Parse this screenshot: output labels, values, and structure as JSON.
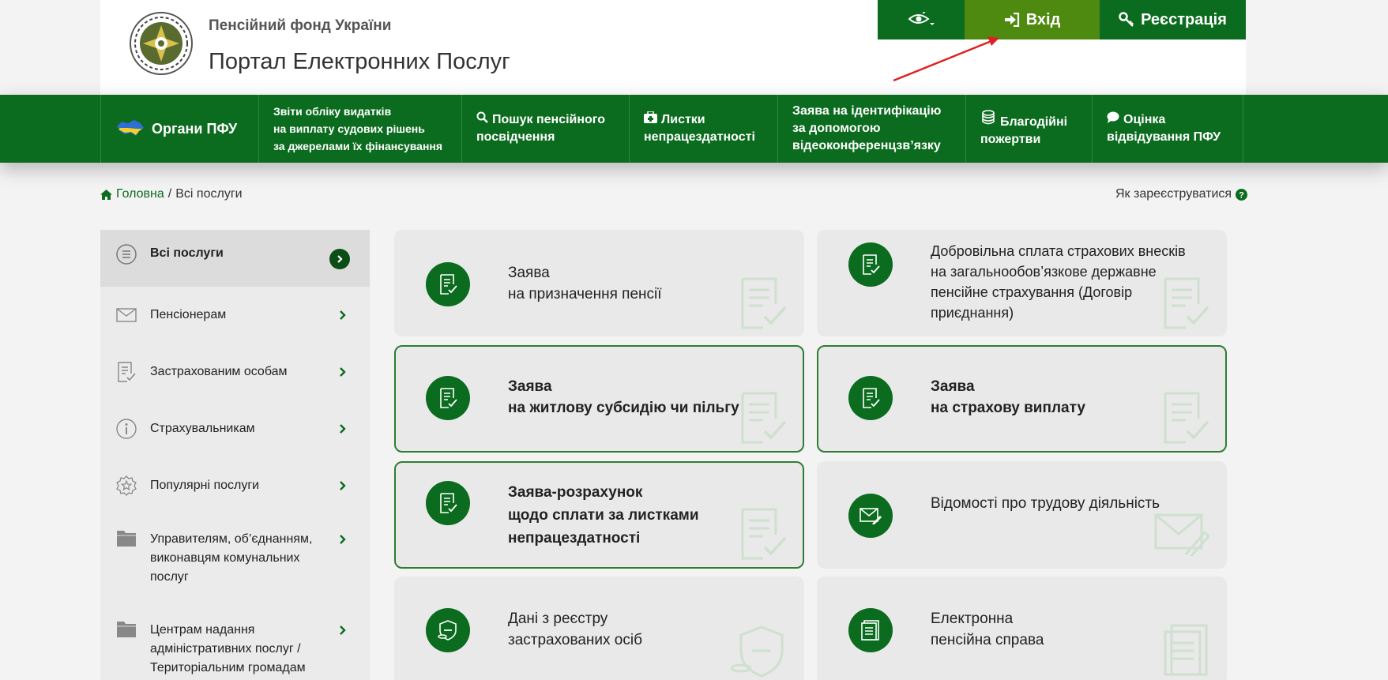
{
  "header": {
    "org_name": "Пенсійний фонд України",
    "portal_name": "Портал Електронних Послуг",
    "accessibility_icon": "eye-icon",
    "login_label": "Вхід",
    "register_label": "Реєстрація"
  },
  "nav": {
    "items": [
      {
        "label": "Органи ПФУ",
        "icon": "ukraine-map-icon"
      },
      {
        "line1": "Звіти обліку видатків",
        "line2": "на виплату судових рішень",
        "line3": "за джерелами їх фінансування"
      },
      {
        "line1": "Пошук пенсійного",
        "line2": "посвідчення",
        "icon": "search-icon"
      },
      {
        "line1": "Листки",
        "line2": "непрацездатності",
        "icon": "medkit-icon"
      },
      {
        "line1": "Заява на ідентифікацію",
        "line2": "за допомогою",
        "line3": "відеоконференцзв’язку"
      },
      {
        "line1": "Благодійні",
        "line2": "пожертви",
        "icon": "coins-icon"
      },
      {
        "line1": "Оцінка",
        "line2": "відвідування ПФУ",
        "icon": "comment-icon"
      }
    ]
  },
  "breadcrumb": {
    "home": "Головна",
    "separator": "/",
    "current": "Всі послуги"
  },
  "help": {
    "how_register": "Як зареєструватися"
  },
  "sidebar": {
    "items": [
      {
        "label": "Всі послуги",
        "icon": "list-icon",
        "active": true
      },
      {
        "label": "Пенсіонерам",
        "icon": "envelope-icon"
      },
      {
        "label": "Застрахованим особам",
        "icon": "document-check-icon"
      },
      {
        "label": "Страхувальникам",
        "icon": "info-icon"
      },
      {
        "label": "Популярні послуги",
        "icon": "star-badge-icon"
      },
      {
        "line1": "Управителям, об’єднанням,",
        "line2": "виконавцям комунальних",
        "line3": "послуг",
        "icon": "folder-icon"
      },
      {
        "line1": "Центрам надання",
        "line2": "адміністративних послуг /",
        "line3": "Територіальним громадам",
        "icon": "folder-icon"
      }
    ]
  },
  "cards": [
    {
      "line1": "Заява",
      "line2": "на призначення пенсії",
      "icon": "document-check-icon"
    },
    {
      "line1": "Добровільна сплата страхових внесків",
      "line2": "на загальнообов’язкове державне",
      "line3": "пенсійне страхування (Договір",
      "line4": "приєднання)",
      "icon": "document-check-icon"
    },
    {
      "line1": "Заява",
      "line2": "на житлову субсидію чи пільгу",
      "icon": "document-check-icon"
    },
    {
      "line1": "Заява",
      "line2": "на страхову виплату",
      "icon": "document-check-icon"
    },
    {
      "line1": "Заява-розрахунок",
      "line2": "щодо сплати за листками",
      "line3": "непрацездатності",
      "icon": "document-check-icon"
    },
    {
      "line1": "Відомості про трудову діяльність",
      "icon": "envelope-pen-icon"
    },
    {
      "line1": "Дані з реєстру",
      "line2": "застрахованих осіб",
      "icon": "shield-coins-icon"
    },
    {
      "line1": "Електронна",
      "line2": "пенсійна справа",
      "icon": "folder-document-icon"
    }
  ],
  "colors": {
    "primary_green": "#0b6b1e",
    "login_green": "#4e8a10",
    "card_bg": "#e9e9e9",
    "annotation_arrow": "#e02020"
  }
}
